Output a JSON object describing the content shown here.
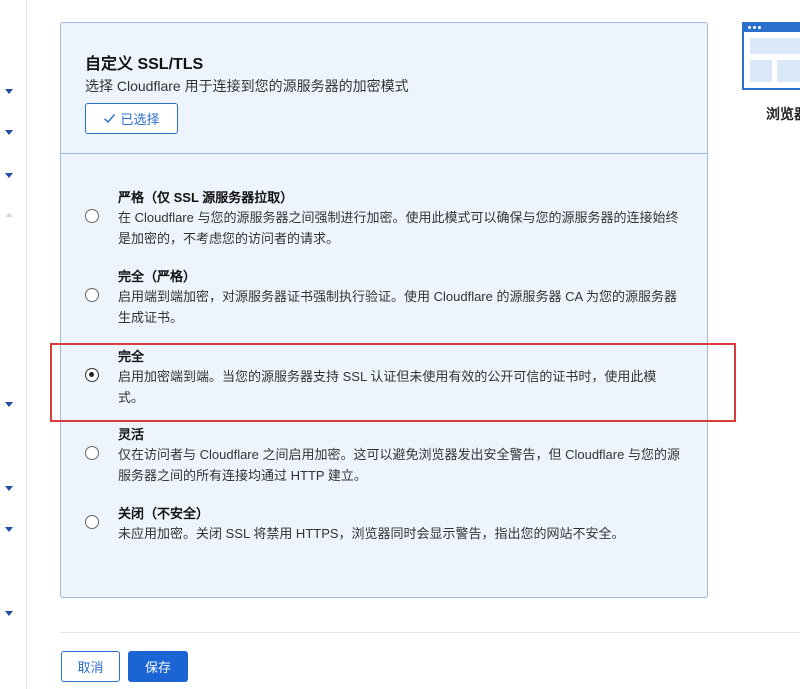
{
  "card": {
    "title": "自定义 SSL/TLS",
    "subtitle": "选择 Cloudflare 用于连接到您的源服务器的加密模式",
    "selected_label": "已选择"
  },
  "options": [
    {
      "title": "严格（仅 SSL 源服务器拉取）",
      "desc": "在 Cloudflare 与您的源服务器之间强制进行加密。使用此模式可以确保与您的源服务器的连接始终是加密的，不考虑您的访问者的请求。",
      "checked": false
    },
    {
      "title": "完全（严格）",
      "desc": "启用端到端加密，对源服务器证书强制执行验证。使用 Cloudflare 的源服务器 CA 为您的源服务器生成证书。",
      "checked": false
    },
    {
      "title": "完全",
      "desc": "启用加密端到端。当您的源服务器支持 SSL 认证但未使用有效的公开可信的证书时，使用此模式。",
      "checked": true
    },
    {
      "title": "灵活",
      "desc": "仅在访问者与 Cloudflare 之间启用加密。这可以避免浏览器发出安全警告，但 Cloudflare 与您的源服务器之间的所有连接均通过 HTTP 建立。",
      "checked": false
    },
    {
      "title": "关闭（不安全）",
      "desc": "未应用加密。关闭 SSL 将禁用 HTTPS，浏览器同时会显示警告，指出您的网站不安全。",
      "checked": false
    }
  ],
  "right_panel": {
    "label": "浏览器"
  },
  "footer": {
    "cancel_label": "取消",
    "save_label": "保存"
  },
  "colors": {
    "accent": "#1b64d6",
    "highlight": "#d93b3b",
    "card_bg": "#eef4fc"
  }
}
